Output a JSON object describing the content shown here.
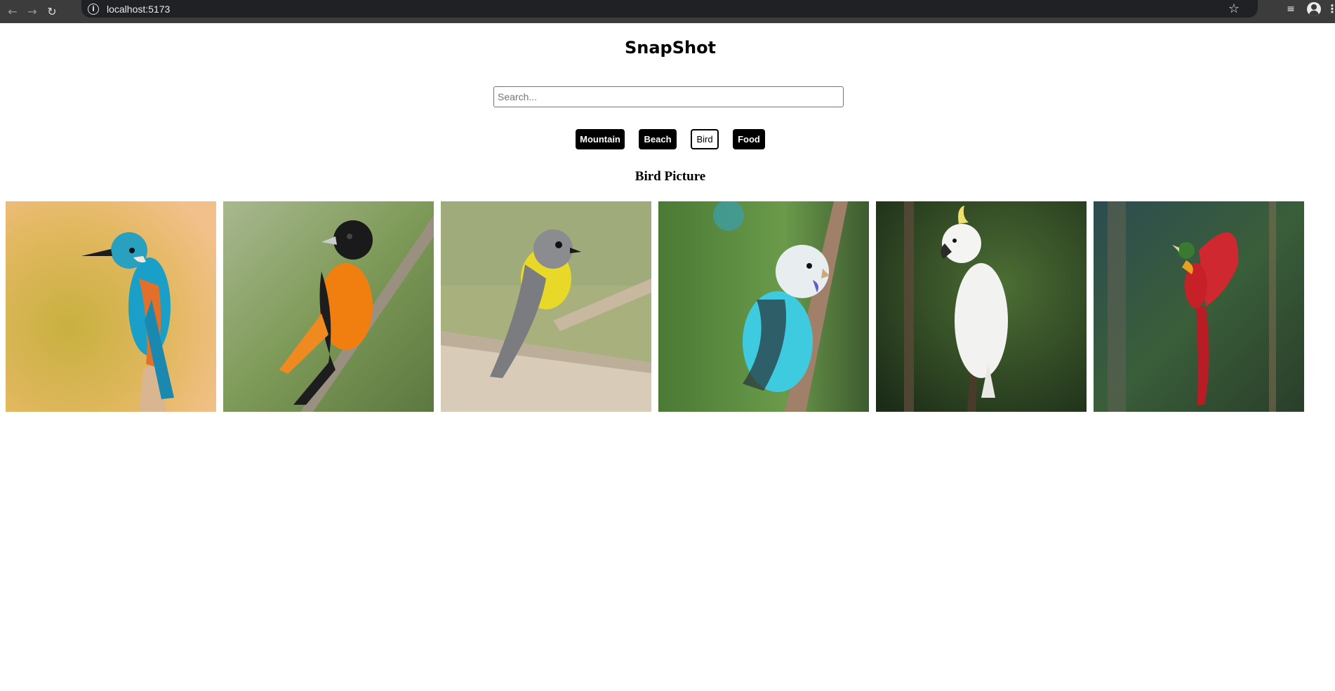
{
  "browser": {
    "url": "localhost:5173",
    "icons": [
      "back-arrow-icon",
      "forward-arrow-icon",
      "reload-icon",
      "site-info-icon",
      "bookmark-star-icon",
      "media-controls-icon",
      "profile-icon",
      "menu-icon"
    ]
  },
  "app": {
    "title": "SnapShot"
  },
  "search": {
    "placeholder": "Search...",
    "value": ""
  },
  "filters": [
    {
      "label": "Mountain",
      "active": false
    },
    {
      "label": "Beach",
      "active": false
    },
    {
      "label": "Bird",
      "active": true
    },
    {
      "label": "Food",
      "active": false
    }
  ],
  "gallery": {
    "heading": "Bird Picture",
    "images": [
      {
        "subject": "kingfisher",
        "colors": {
          "bg": "#e0b86a",
          "body": "#1aa0c8",
          "breast": "#e0702a"
        }
      },
      {
        "subject": "oriole",
        "colors": {
          "bg": "#7e9a58",
          "body": "#f07f10",
          "head": "#1a1a1a"
        }
      },
      {
        "subject": "yellow robin",
        "colors": {
          "bg": "#a8b07e",
          "body": "#e8d828",
          "head": "#8a8c90"
        }
      },
      {
        "subject": "budgerigar",
        "colors": {
          "bg": "#5a8a40",
          "body": "#3ecbe0",
          "head": "#e8eef0"
        }
      },
      {
        "subject": "cockatoo",
        "colors": {
          "bg": "#2e4a24",
          "body": "#f2f2f0",
          "crest": "#f0e070"
        }
      },
      {
        "subject": "bird of paradise",
        "colors": {
          "bg": "#3a5e3a",
          "body": "#d02830",
          "head": "#3a7a30"
        }
      }
    ]
  }
}
